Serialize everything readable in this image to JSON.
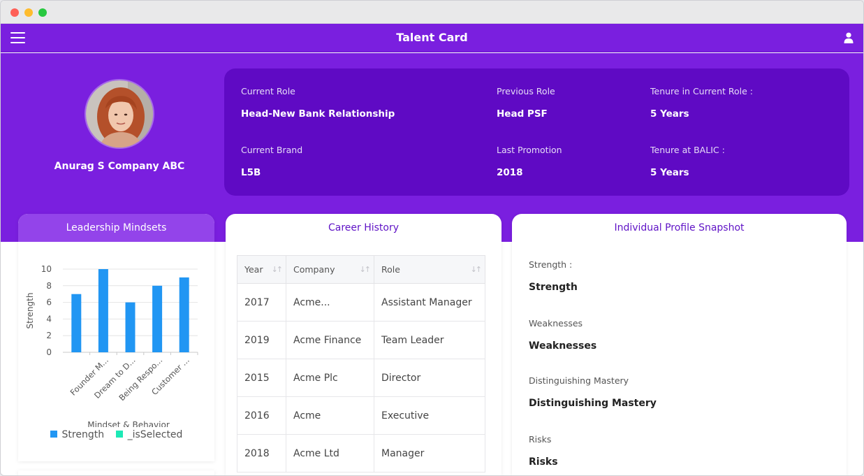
{
  "app": {
    "title": "Talent Card"
  },
  "profile": {
    "name": "Anurag S Company ABC"
  },
  "info": {
    "current_role_label": "Current Role",
    "current_role": "Head-New Bank Relationship",
    "previous_role_label": "Previous Role",
    "previous_role": "Head PSF",
    "tenure_current_label": "Tenure in Current Role :",
    "tenure_current": "5 Years",
    "current_brand_label": "Current Brand",
    "current_brand": "L5B",
    "last_promotion_label": "Last Promotion",
    "last_promotion": "2018",
    "tenure_balic_label": "Tenure at BALIC :",
    "tenure_balic": "5 Years"
  },
  "mindsets": {
    "title": "Leadership Mindsets",
    "legend": [
      {
        "name": "Strength",
        "color": "#2196f3"
      },
      {
        "name": "_isSelected",
        "color": "#1de9b6"
      }
    ]
  },
  "chart_data": {
    "type": "bar",
    "categories": [
      "",
      "Founder M...",
      "Dream to D...",
      "Being Respo...",
      "Customer ..."
    ],
    "series": [
      {
        "name": "Strength",
        "values": [
          7,
          10,
          6,
          8,
          9
        ]
      }
    ],
    "ylabel": "Strength",
    "xlabel": "Mindset & Behavior",
    "ylim": [
      0,
      10
    ],
    "yticks": [
      0,
      2,
      4,
      6,
      8,
      10
    ],
    "grid": true,
    "legend_position": "bottom"
  },
  "career": {
    "title": "Career History",
    "columns": [
      "Year",
      "Company",
      "Role"
    ],
    "rows": [
      [
        "2017",
        "Acme...",
        "Assistant Manager"
      ],
      [
        "2019",
        "Acme Finance",
        "Team Leader"
      ],
      [
        "2015",
        "Acme Plc",
        "Director"
      ],
      [
        "2016",
        "Acme",
        "Executive"
      ],
      [
        "2018",
        "Acme Ltd",
        "Manager"
      ]
    ]
  },
  "snapshot": {
    "title": "Individual Profile Snapshot",
    "items": [
      {
        "label": "Strength :",
        "value": "Strength"
      },
      {
        "label": "Weaknesses",
        "value": "Weaknesses"
      },
      {
        "label": "Distinguishing Mastery",
        "value": "Distinguishing Mastery"
      },
      {
        "label": "Risks",
        "value": "Risks"
      }
    ]
  },
  "icons": {
    "menu": "hamburger-icon",
    "user": "user-icon"
  }
}
